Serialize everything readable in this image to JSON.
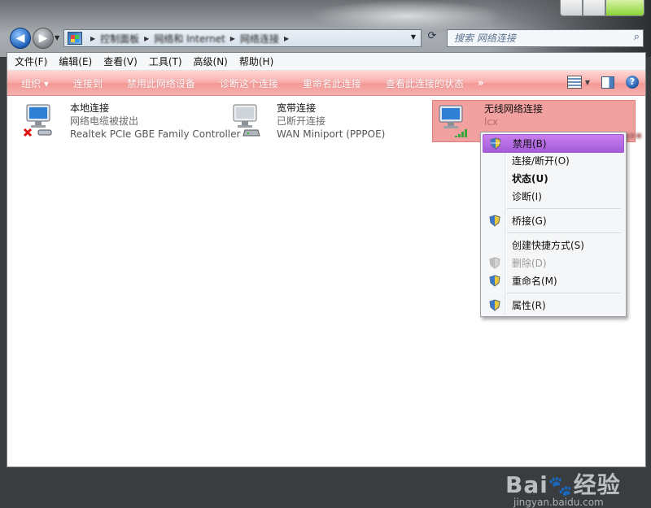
{
  "nav": {
    "back_icon": "back-arrow-icon",
    "forward_icon": "forward-arrow-icon",
    "breadcrumb": [
      "控制面板",
      "网络和 Internet",
      "网络连接"
    ],
    "search_placeholder": "搜索 网络连接"
  },
  "menubar": [
    "文件(F)",
    "编辑(E)",
    "查看(V)",
    "工具(T)",
    "高级(N)",
    "帮助(H)"
  ],
  "commandbar": {
    "items": [
      "组织 ▾",
      "连接到",
      "禁用此网络设备",
      "诊断这个连接",
      "重命名此连接",
      "查看此连接的状态"
    ],
    "more": "»",
    "accent_color": "#f39895"
  },
  "connections": [
    {
      "name": "本地连接",
      "status": "网络电缆被拔出",
      "device": "Realtek PCIe GBE Family Controller",
      "icon": "lan-disconnected-icon"
    },
    {
      "name": "宽带连接",
      "status": "已断开连接",
      "device": "WAN Miniport (PPPOE)",
      "icon": "broadband-modem-icon"
    },
    {
      "name": "无线网络连接",
      "status": "lcx",
      "device": "",
      "icon": "wifi-signal-icon"
    }
  ],
  "context_menu": {
    "highlight_color": "#b26ae0",
    "items": [
      {
        "label": "禁用(B)",
        "shield": true
      },
      {
        "label": "连接/断开(O)",
        "shield": false
      },
      {
        "label": "状态(U)",
        "shield": false
      },
      {
        "label": "诊断(I)",
        "shield": false
      },
      {
        "label": "桥接(G)",
        "shield": true
      },
      {
        "label": "创建快捷方式(S)",
        "shield": false
      },
      {
        "label": "删除(D)",
        "shield": true
      },
      {
        "label": "重命名(M)",
        "shield": true
      },
      {
        "label": "属性(R)",
        "shield": true
      }
    ]
  },
  "watermark": {
    "logo": "Bai du 经验",
    "url": "jingyan.baidu.com"
  }
}
